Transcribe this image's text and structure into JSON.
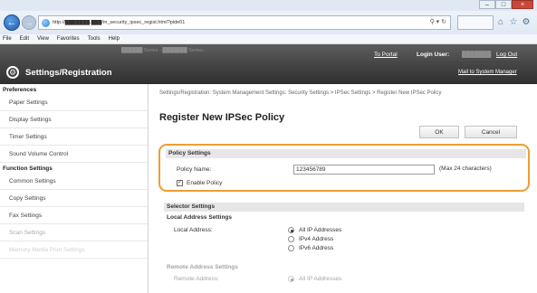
{
  "browser": {
    "address": "http://███████.███/m_security_ipsec_regist.html?pide01",
    "menu": [
      "File",
      "Edit",
      "View",
      "Favorites",
      "Tools",
      "Help"
    ],
    "window_controls": [
      "–",
      "□",
      "×"
    ]
  },
  "header": {
    "device_info": "██████  Series - ███████  Series -",
    "portal_link": "To Portal",
    "login_label": "Login User:",
    "login_user": "███████",
    "logout": "Log Out",
    "title": "Settings/Registration",
    "mail_link": "Mail to System Manager"
  },
  "sidebar": {
    "preferences_head": "Preferences",
    "preferences": [
      "Paper Settings",
      "Display Settings",
      "Timer Settings",
      "Sound Volume Control"
    ],
    "function_head": "Function Settings",
    "functions": [
      "Common Settings",
      "Copy Settings",
      "Fax Settings",
      "Scan Settings",
      "Memory Media Print Settings"
    ]
  },
  "main": {
    "breadcrumb": "Settings/Registration: System Management Settings: Security Settings > IPSec Settings > Register New IPSec Policy",
    "title": "Register New IPSec Policy",
    "ok": "OK",
    "cancel": "Cancel",
    "policy": {
      "heading": "Policy Settings",
      "name_label": "Policy Name:",
      "name_value": "123456789",
      "hint": "(Max 24 characters)",
      "enable_label": "Enable Policy",
      "enable_checked": true
    },
    "selector": {
      "heading": "Selector Settings",
      "local_head": "Local Address Settings",
      "local_label": "Local Address:",
      "local_options": [
        "All IP Addresses",
        "IPv4 Address",
        "IPv6 Address"
      ],
      "local_selected": "All IP Addresses",
      "remote_head": "Remote Address Settings",
      "remote_label": "Remote Address:",
      "remote_options": [
        "All IP Addresses"
      ]
    }
  }
}
